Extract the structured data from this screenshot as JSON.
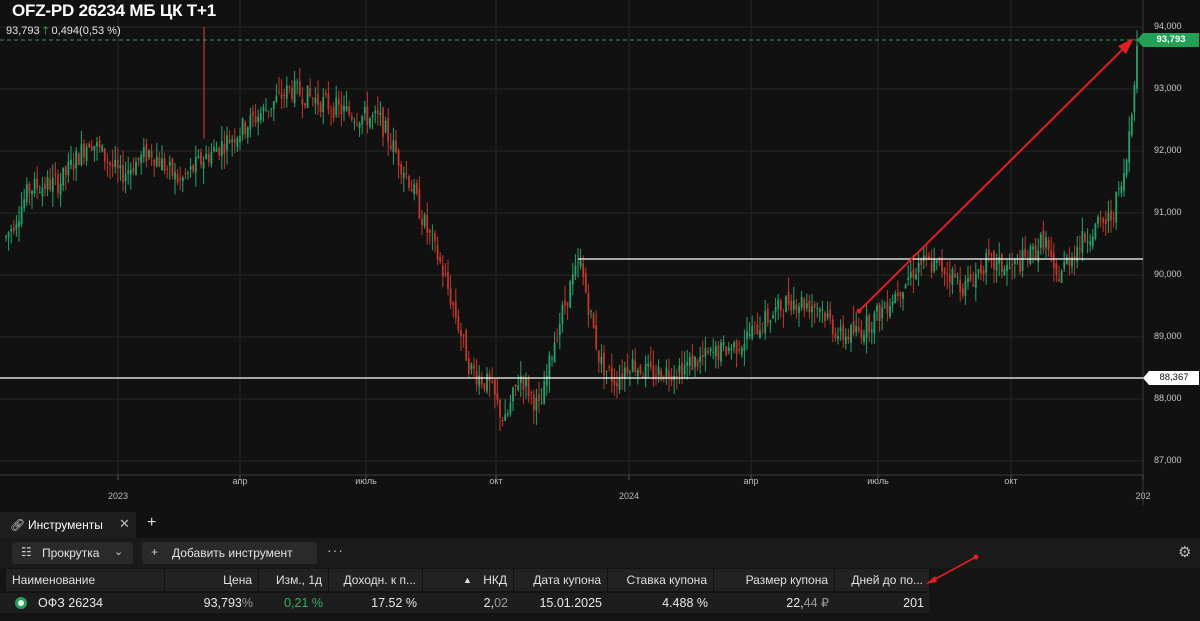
{
  "header": {
    "ticker": "OFZ-PD 26234 МБ ЦК Т+1",
    "last_price": "93,793",
    "change_arrow": "🡑",
    "change": "0,494(0,53 %)"
  },
  "price_axis": {
    "labels": [
      "94,000",
      "93,000",
      "92,000",
      "91,000",
      "90,000",
      "89,000",
      "88,000",
      "87,000"
    ],
    "current_tag": "93,793",
    "level_tag": "88,367"
  },
  "time_axis": {
    "months": [
      "апр",
      "июль",
      "окт",
      "апр",
      "июль",
      "окт"
    ],
    "years": [
      "2023",
      "2024",
      "202"
    ]
  },
  "colors": {
    "up": "#26a269",
    "down": "#c0392b",
    "accent_green": "#22a055",
    "annotation_red": "#e02020",
    "level_line": "#ffffff"
  },
  "panel": {
    "tab_label": "Инструменты",
    "tab_icon": "link-icon",
    "toolbar": {
      "scroll_label": "Прокрутка",
      "add_label": "Добавить инструмент"
    },
    "columns": [
      "Наименование",
      "Цена",
      "Изм., 1д",
      "Доходн. к п...",
      "НКД",
      "Дата купона",
      "Ставка купона",
      "Размер купона",
      "Дней до по..."
    ],
    "sort_indicator": "▲",
    "row": {
      "name": "ОФЗ 26234",
      "price_main": "93,793",
      "price_unit": "%",
      "change": "0,21 %",
      "yield": "17.52 %",
      "nkd_main": "2,",
      "nkd_frac": "02",
      "coupon_date": "15.01.2025",
      "coupon_rate": "4.488 %",
      "coupon_size_main": "22,",
      "coupon_size_frac": "44",
      "coupon_currency": "₽",
      "days_to": "201"
    }
  }
}
